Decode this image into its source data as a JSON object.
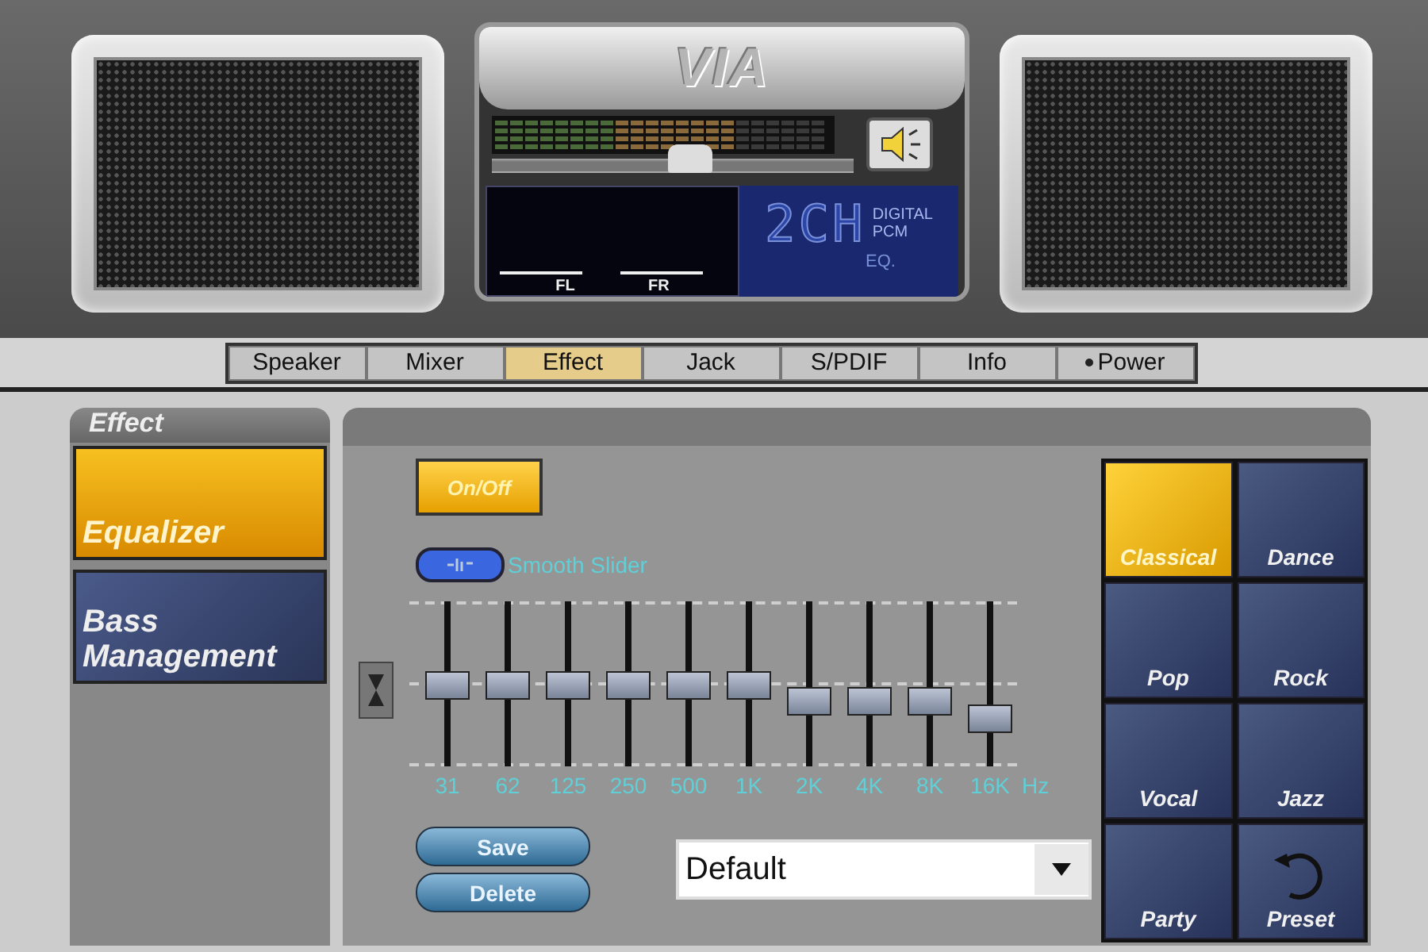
{
  "logo": "VIA",
  "display": {
    "volume": {
      "level": 0.55
    },
    "channels": [
      "FL",
      "FR"
    ],
    "mode": "2CH",
    "format_lines": [
      "DIGITAL",
      "PCM"
    ],
    "eq_label": "EQ."
  },
  "tabs": [
    {
      "label": "Speaker",
      "selected": false
    },
    {
      "label": "Mixer",
      "selected": false
    },
    {
      "label": "Effect",
      "selected": true
    },
    {
      "label": "Jack",
      "selected": false
    },
    {
      "label": "S/PDIF",
      "selected": false
    },
    {
      "label": "Info",
      "selected": false
    },
    {
      "label": "Power",
      "selected": false,
      "kind": "dot"
    }
  ],
  "sidebar": {
    "title": "Effect",
    "items": [
      {
        "label": "Equalizer",
        "selected": true
      },
      {
        "label": "Bass Management",
        "selected": false
      }
    ]
  },
  "equalizer": {
    "power": {
      "label": "On/Off",
      "on": true
    },
    "smooth_slider": {
      "label": "Smooth Slider",
      "on": true
    },
    "bands": [
      {
        "label": "31",
        "level": 0.5
      },
      {
        "label": "62",
        "level": 0.5
      },
      {
        "label": "125",
        "level": 0.5
      },
      {
        "label": "250",
        "level": 0.5
      },
      {
        "label": "500",
        "level": 0.5
      },
      {
        "label": "1K",
        "level": 0.5
      },
      {
        "label": "2K",
        "level": 0.4
      },
      {
        "label": "4K",
        "level": 0.4
      },
      {
        "label": "8K",
        "level": 0.4
      },
      {
        "label": "16K",
        "level": 0.3
      }
    ],
    "unit": "Hz",
    "buttons": [
      "Save",
      "Delete"
    ],
    "preset_select": {
      "value": "Default"
    }
  },
  "presets": [
    {
      "label": "Classical",
      "selected": true
    },
    {
      "label": "Dance",
      "selected": false
    },
    {
      "label": "Pop",
      "selected": false
    },
    {
      "label": "Rock",
      "selected": false
    },
    {
      "label": "Vocal",
      "selected": false
    },
    {
      "label": "Jazz",
      "selected": false
    },
    {
      "label": "Party",
      "selected": false
    },
    {
      "label": "Preset",
      "selected": false,
      "kind": "reset"
    }
  ]
}
